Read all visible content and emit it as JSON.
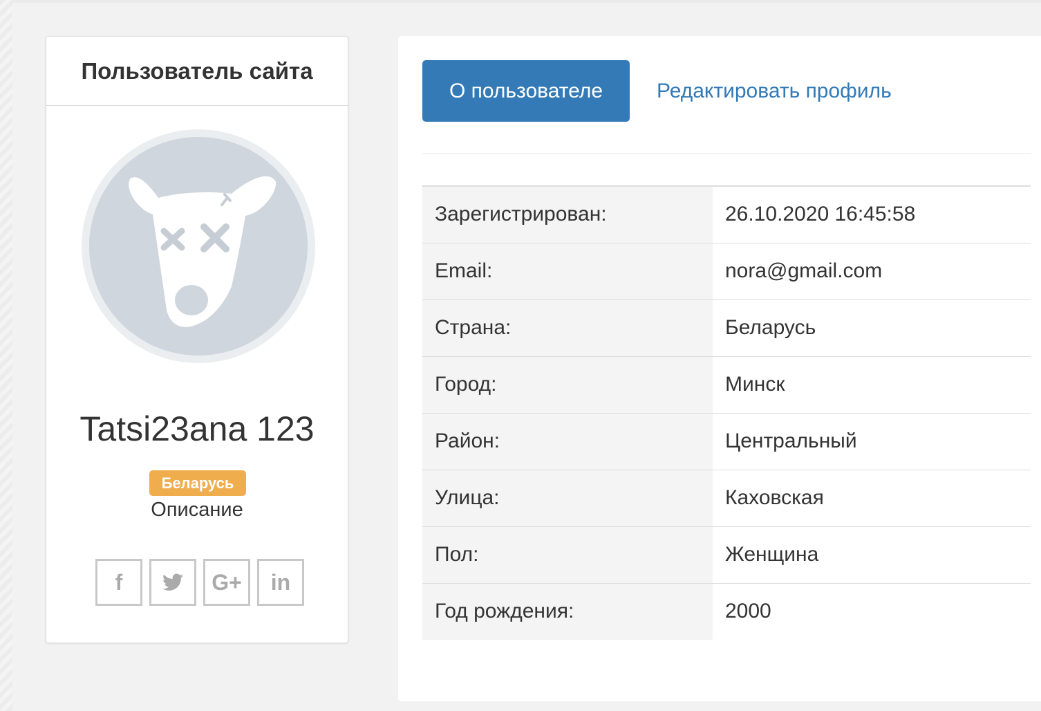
{
  "profile_card": {
    "title": "Пользователь сайта",
    "user_name": "Tatsi23ana 123",
    "country_badge": "Беларусь",
    "description": "Описание",
    "social": [
      {
        "icon": "facebook-icon",
        "glyph": "f"
      },
      {
        "icon": "twitter-icon",
        "glyph": "🐦"
      },
      {
        "icon": "google-plus-icon",
        "glyph": "G+"
      },
      {
        "icon": "linkedin-icon",
        "glyph": "in"
      }
    ]
  },
  "tabs": {
    "about": "О пользователе",
    "edit": "Редактировать профиль"
  },
  "info_rows": [
    {
      "label": "Зарегистрирован:",
      "value": "26.10.2020 16:45:58"
    },
    {
      "label": "Email:",
      "value": "nora@gmail.com"
    },
    {
      "label": "Страна:",
      "value": "Беларусь"
    },
    {
      "label": "Город:",
      "value": "Минск"
    },
    {
      "label": "Район:",
      "value": "Центральный"
    },
    {
      "label": "Улица:",
      "value": "Каховская"
    },
    {
      "label": "Пол:",
      "value": "Женщина"
    },
    {
      "label": "Год рождения:",
      "value": "2000"
    }
  ],
  "colors": {
    "primary": "#337ab7",
    "badge": "#f0ad4e",
    "avatar_bg": "#d0d6de"
  }
}
